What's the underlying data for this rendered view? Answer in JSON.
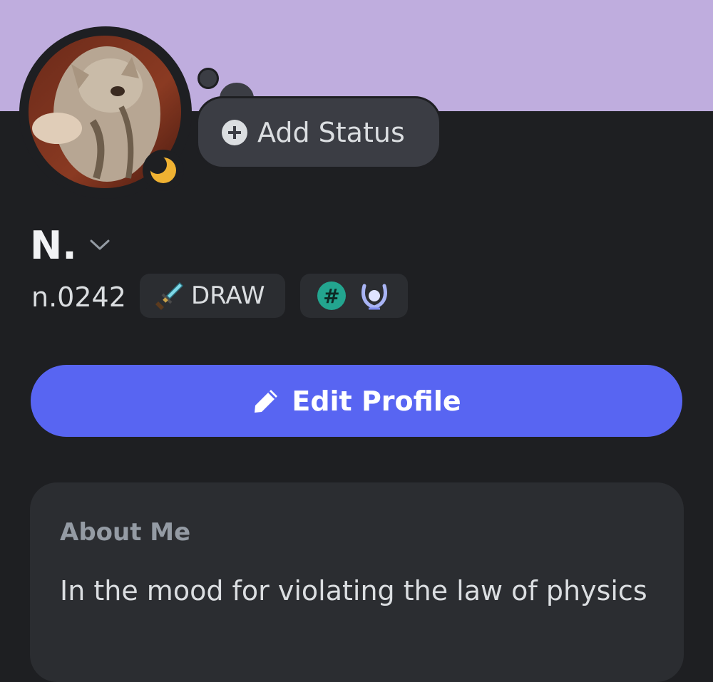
{
  "profile": {
    "display_name": "N.",
    "username": "n.0242",
    "status_button_label": "Add Status",
    "tag": {
      "label": "DRAW",
      "icon": "sword-icon"
    },
    "badges": [
      "hash-badge-icon",
      "laurel-badge-icon"
    ],
    "hash_badge_text": "#",
    "presence": "idle-moon-icon"
  },
  "actions": {
    "edit_profile_label": "Edit Profile"
  },
  "about": {
    "title": "About Me",
    "text": "In the mood for violating the law of physics"
  },
  "colors": {
    "banner": "#bfadde",
    "background": "#1e1f22",
    "card": "#2b2d31",
    "accent": "#5865f2",
    "idle": "#f0b232"
  }
}
